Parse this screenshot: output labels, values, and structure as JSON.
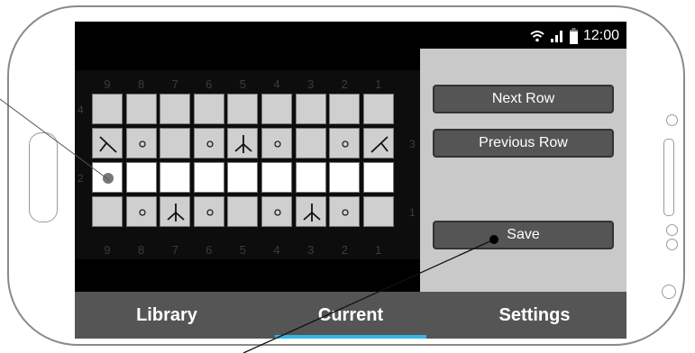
{
  "status": {
    "time": "12:00",
    "icons": [
      "wifi-icon",
      "signal-icon",
      "battery-icon"
    ]
  },
  "grid": {
    "column_numbers_top": [
      "9",
      "8",
      "7",
      "6",
      "5",
      "4",
      "3",
      "2",
      "1"
    ],
    "column_numbers_bottom": [
      "9",
      "8",
      "7",
      "6",
      "5",
      "4",
      "3",
      "2",
      "1"
    ],
    "row_numbers": {
      "row4": "4",
      "row3": "3",
      "row2": "2",
      "row1": "1"
    },
    "rows": [
      {
        "row": "4",
        "highlight": false,
        "symbols": [
          "",
          "",
          "",
          "",
          "",
          "",
          "",
          "",
          ""
        ]
      },
      {
        "row": "3",
        "highlight": false,
        "symbols": [
          "k2tog-right",
          "yarn-over",
          "",
          "yarn-over",
          "sk2p",
          "yarn-over",
          "",
          "yarn-over",
          "ssk-left"
        ]
      },
      {
        "row": "2",
        "highlight": true,
        "symbols": [
          "current-dot",
          "",
          "",
          "",
          "",
          "",
          "",
          "",
          ""
        ]
      },
      {
        "row": "1",
        "highlight": false,
        "symbols": [
          "",
          "yarn-over",
          "sk2p",
          "yarn-over",
          "",
          "yarn-over",
          "sk2p",
          "yarn-over",
          ""
        ]
      }
    ]
  },
  "panel": {
    "next_row": "Next Row",
    "previous_row": "Previous Row",
    "save": "Save"
  },
  "tabs": [
    {
      "label": "Library",
      "active": false
    },
    {
      "label": "Current",
      "active": true
    },
    {
      "label": "Settings",
      "active": false
    }
  ],
  "colors": {
    "accent": "#34b7e6",
    "tabbar": "#555555",
    "panel": "#c9c9c9"
  }
}
